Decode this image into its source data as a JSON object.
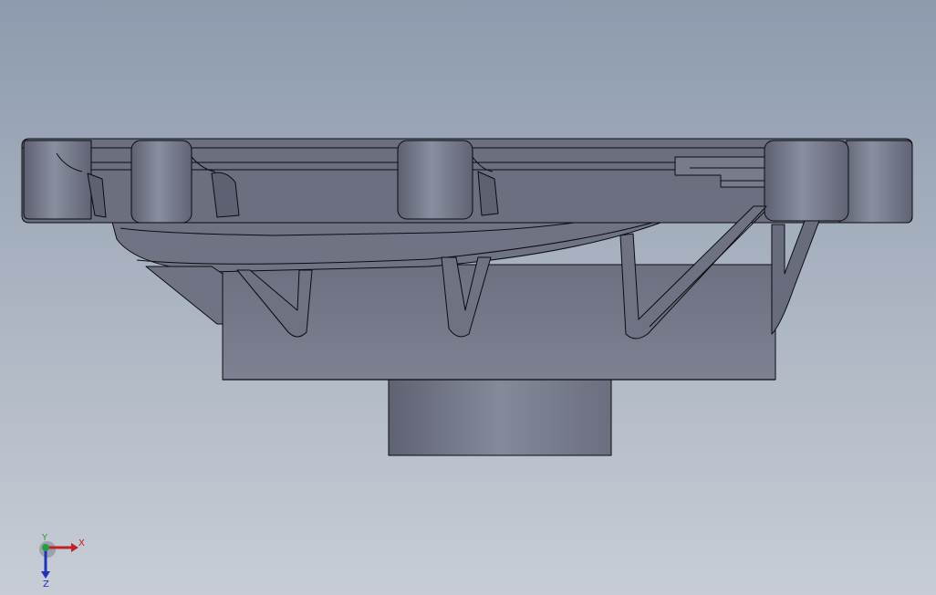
{
  "viewport": {
    "background_top": "#8f9db0",
    "background_bottom": "#c9ced6",
    "model_fill": "#7a7f8f",
    "model_fill_light": "#8a8fa0",
    "model_fill_dark": "#5f6373",
    "edge_color": "#0b0b10"
  },
  "triad": {
    "x_label": "X",
    "y_label": "Y",
    "z_label": "Z",
    "x_color": "#c0202a",
    "y_color": "#20a040",
    "z_color": "#2030c0"
  }
}
